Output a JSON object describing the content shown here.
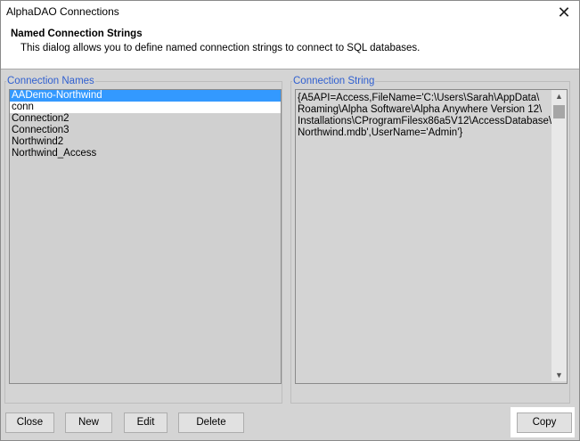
{
  "window": {
    "title": "AlphaDAO Connections"
  },
  "header": {
    "title": "Named Connection Strings",
    "description": "This dialog allows you to define named connection strings to connect to SQL databases."
  },
  "names_group": {
    "label": "Connection Names",
    "items": [
      {
        "label": "AADemo-Northwind",
        "state": "selected"
      },
      {
        "label": "conn",
        "state": "normal"
      },
      {
        "label": "Connection2",
        "state": "normal"
      },
      {
        "label": "Connection3",
        "state": "normal"
      },
      {
        "label": "Northwind2",
        "state": "normal"
      },
      {
        "label": "Northwind_Access",
        "state": "normal"
      }
    ]
  },
  "connection_group": {
    "label": "Connection String",
    "value": "{A5API=Access,FileName='C:\\Users\\Sarah\\AppData\\\nRoaming\\Alpha Software\\Alpha Anywhere Version 12\\\nInstallations\\CProgramFilesx86a5V12\\AccessDatabase\\\nNorthwind.mdb',UserName='Admin'}"
  },
  "buttons": {
    "close": "Close",
    "new": "New",
    "edit": "Edit",
    "delete": "Delete",
    "copy": "Copy"
  },
  "colors": {
    "selection": "#3399ff",
    "group_label": "#2f5fd0",
    "dialog_bg": "#d4d4d4"
  }
}
